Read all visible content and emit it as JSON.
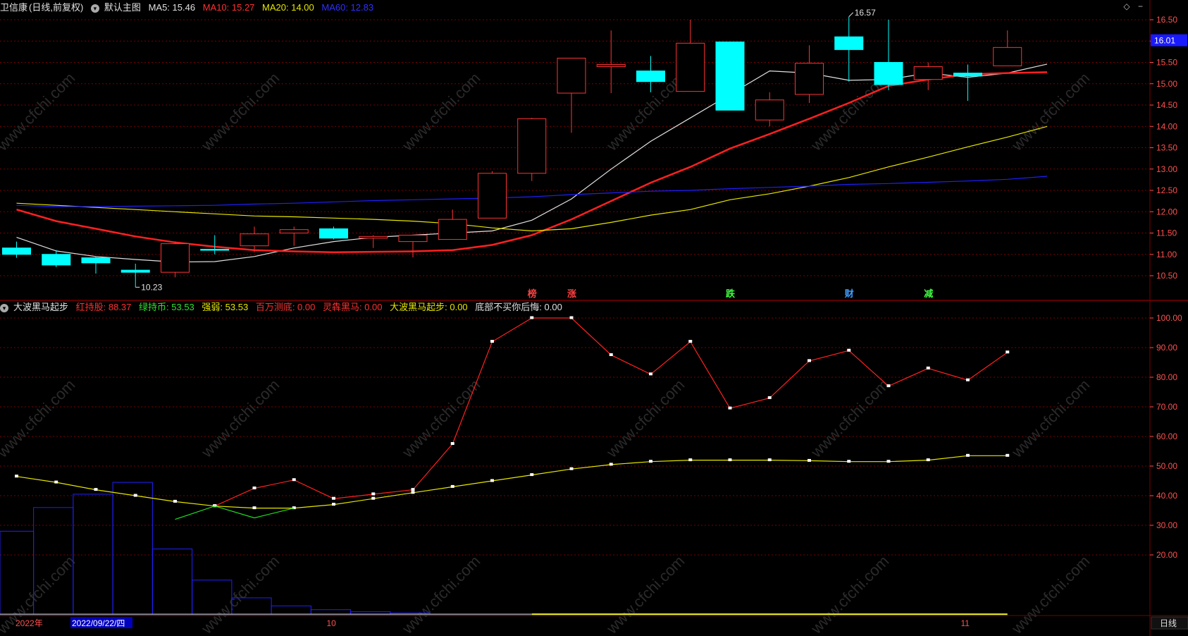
{
  "header_top": {
    "stock_name": "卫信康",
    "period_info": "(日线,前复权)",
    "main_chart_label": "默认主图",
    "ma5": "MA5: 15.46",
    "ma10": "MA10: 15.27",
    "ma20": "MA20: 14.00",
    "ma60": "MA60: 12.83"
  },
  "header_bottom": {
    "indicator_name": "大波黑马起步",
    "v1": "红持股: 88.37",
    "v2": "绿持币: 53.53",
    "v3": "强弱: 53.53",
    "v4": "百万测底: 0.00",
    "v5": "灵犇黑马: 0.00",
    "v6": "大波黑马起步: 0.00",
    "v7": "底部不买你后悔: 0.00"
  },
  "window_icons": {
    "diamond": "◇",
    "minus": "−"
  },
  "current_price": "16.01",
  "bottom_bar": {
    "year_label": "2022年",
    "date_label": "2022/09/22/四",
    "month_oct": "10",
    "month_nov": "11",
    "period_button": "日线"
  },
  "signals": [
    {
      "idx": 13,
      "text": "榜",
      "color": "#ff4040"
    },
    {
      "idx": 14,
      "text": "涨",
      "color": "#ff4040"
    },
    {
      "idx": 18,
      "text": "跌",
      "color": "#40ff40"
    },
    {
      "idx": 21,
      "text": "财",
      "color": "#40a0ff"
    },
    {
      "idx": 23,
      "text": "减",
      "color": "#40ff40"
    }
  ],
  "watermark": "www.cfchi.com",
  "colors": {
    "up": "#ff3232",
    "down": "#00ffff",
    "ma5": "#e0e0e0",
    "ma10": "#ff2020",
    "ma20": "#e6e600",
    "ma60": "#1f1fff",
    "grid": "#7a0000",
    "axis_text": "#ff5050"
  },
  "chart_data": [
    {
      "type": "candlestick",
      "ylim": [
        10.2,
        16.7
      ],
      "yticks": [
        "16.50",
        "16.00",
        "15.50",
        "15.00",
        "14.50",
        "14.00",
        "13.50",
        "13.00",
        "12.50",
        "12.00",
        "11.50",
        "11.00",
        "10.50"
      ],
      "annotations": [
        {
          "idx": 3,
          "text": "10.23",
          "value": 10.23
        },
        {
          "idx": 21,
          "text": "16.57",
          "value": 16.57
        }
      ],
      "candles": [
        {
          "o": 11.15,
          "h": 11.3,
          "l": 10.92,
          "c": 11.0
        },
        {
          "o": 11.0,
          "h": 11.1,
          "l": 10.7,
          "c": 10.75
        },
        {
          "o": 10.92,
          "h": 10.95,
          "l": 10.55,
          "c": 10.8
        },
        {
          "o": 10.63,
          "h": 10.78,
          "l": 10.23,
          "c": 10.58
        },
        {
          "o": 10.58,
          "h": 11.3,
          "l": 10.46,
          "c": 11.25
        },
        {
          "o": 11.12,
          "h": 11.45,
          "l": 11.0,
          "c": 11.1
        },
        {
          "o": 11.2,
          "h": 11.65,
          "l": 11.05,
          "c": 11.48
        },
        {
          "o": 11.5,
          "h": 11.65,
          "l": 11.2,
          "c": 11.58
        },
        {
          "o": 11.6,
          "h": 11.65,
          "l": 11.35,
          "c": 11.38
        },
        {
          "o": 11.38,
          "h": 11.45,
          "l": 11.15,
          "c": 11.42
        },
        {
          "o": 11.3,
          "h": 11.45,
          "l": 10.93,
          "c": 11.45
        },
        {
          "o": 11.35,
          "h": 12.05,
          "l": 11.35,
          "c": 11.82
        },
        {
          "o": 11.85,
          "h": 12.95,
          "l": 11.85,
          "c": 12.9
        },
        {
          "o": 12.9,
          "h": 14.2,
          "l": 12.72,
          "c": 14.18
        },
        {
          "o": 14.78,
          "h": 15.6,
          "l": 13.85,
          "c": 15.6
        },
        {
          "o": 15.4,
          "h": 16.25,
          "l": 14.78,
          "c": 15.45
        },
        {
          "o": 15.3,
          "h": 15.65,
          "l": 14.8,
          "c": 15.05
        },
        {
          "o": 14.82,
          "h": 16.5,
          "l": 14.82,
          "c": 15.95
        },
        {
          "o": 15.98,
          "h": 15.98,
          "l": 14.38,
          "c": 14.38
        },
        {
          "o": 14.15,
          "h": 14.8,
          "l": 14.0,
          "c": 14.62
        },
        {
          "o": 14.75,
          "h": 15.9,
          "l": 14.55,
          "c": 15.48
        },
        {
          "o": 16.1,
          "h": 16.57,
          "l": 15.05,
          "c": 15.8
        },
        {
          "o": 15.5,
          "h": 16.5,
          "l": 14.85,
          "c": 14.98
        },
        {
          "o": 15.1,
          "h": 15.5,
          "l": 14.85,
          "c": 15.4
        },
        {
          "o": 15.25,
          "h": 15.45,
          "l": 14.6,
          "c": 15.18
        },
        {
          "o": 15.42,
          "h": 16.25,
          "l": 15.42,
          "c": 15.85
        }
      ],
      "series": [
        {
          "name": "MA5",
          "color": "#e0e0e0",
          "values": [
            11.4,
            11.08,
            10.95,
            10.88,
            10.82,
            10.83,
            10.95,
            11.15,
            11.3,
            11.4,
            11.45,
            11.5,
            11.55,
            11.8,
            12.3,
            13.0,
            13.65,
            14.2,
            14.75,
            15.3,
            15.25,
            15.08,
            15.1,
            15.25,
            15.15,
            15.25,
            15.46
          ]
        },
        {
          "name": "MA10",
          "color": "#ff2020",
          "values": [
            12.05,
            11.78,
            11.6,
            11.42,
            11.28,
            11.18,
            11.1,
            11.07,
            11.05,
            11.06,
            11.07,
            11.1,
            11.22,
            11.45,
            11.82,
            12.25,
            12.68,
            13.05,
            13.48,
            13.82,
            14.18,
            14.55,
            14.95,
            15.1,
            15.22,
            15.25,
            15.27
          ]
        },
        {
          "name": "MA20",
          "color": "#e6e600",
          "values": [
            12.2,
            12.15,
            12.1,
            12.05,
            12.0,
            11.95,
            11.9,
            11.88,
            11.85,
            11.82,
            11.78,
            11.72,
            11.62,
            11.55,
            11.6,
            11.75,
            11.92,
            12.05,
            12.28,
            12.42,
            12.6,
            12.8,
            13.05,
            13.28,
            13.52,
            13.75,
            14.0
          ]
        },
        {
          "name": "MA60",
          "color": "#1f1fff",
          "values": [
            12.15,
            12.12,
            12.12,
            12.13,
            12.14,
            12.15,
            12.18,
            12.2,
            12.23,
            12.26,
            12.28,
            12.3,
            12.32,
            12.35,
            12.4,
            12.44,
            12.48,
            12.5,
            12.54,
            12.57,
            12.6,
            12.64,
            12.66,
            12.69,
            12.72,
            12.76,
            12.83
          ]
        }
      ]
    },
    {
      "type": "line",
      "ylim": [
        0,
        103
      ],
      "yticks": [
        "100.00",
        "90.00",
        "80.00",
        "70.00",
        "60.00",
        "50.00",
        "40.00",
        "30.00",
        "20.00"
      ],
      "x_labels": [
        {
          "idx": 0,
          "text": "2022年"
        },
        {
          "idx": 2,
          "text": "2022/09/22/四"
        },
        {
          "idx": 8,
          "text": "10"
        },
        {
          "idx": 24,
          "text": "11"
        }
      ],
      "bars": {
        "name": "blue-bars",
        "values": [
          28,
          36,
          40.5,
          44.5,
          22,
          11.5,
          5.5,
          2.8,
          1.5,
          0.8,
          0.4,
          0.2,
          0.1,
          0.1,
          0.1,
          0.1,
          0.05,
          0.05,
          0.05,
          0.05,
          0.05,
          0.05,
          0.05,
          0.05,
          0.05,
          0.05
        ]
      },
      "series": [
        {
          "color": "#ff2020",
          "values": [
            null,
            null,
            null,
            null,
            null,
            36.5,
            42.5,
            45.3,
            39.0,
            40.5,
            42.0,
            57.5,
            92.0,
            100.0,
            100.0,
            87.5,
            81.0,
            92.0,
            69.5,
            73.0,
            85.5,
            89.0,
            77.0,
            83.0,
            79.0,
            88.4
          ]
        },
        {
          "color": "#e6e600",
          "values": [
            46.5,
            44.5,
            42.0,
            40.0,
            38.0,
            36.5,
            35.8,
            35.8,
            37.0,
            39.0,
            41.0,
            43.0,
            45.0,
            47.0,
            49.0,
            50.5,
            51.5,
            52.0,
            52.0,
            52.0,
            51.8,
            51.5,
            51.5,
            52.0,
            53.5,
            53.5
          ]
        },
        {
          "color": "#20e020",
          "values": [
            null,
            null,
            null,
            null,
            32.0,
            36.5,
            32.5,
            35.8,
            null,
            null,
            null,
            null,
            null,
            null,
            null,
            null,
            null,
            null,
            null,
            null,
            null,
            null,
            null,
            null,
            null,
            null
          ]
        }
      ]
    }
  ]
}
